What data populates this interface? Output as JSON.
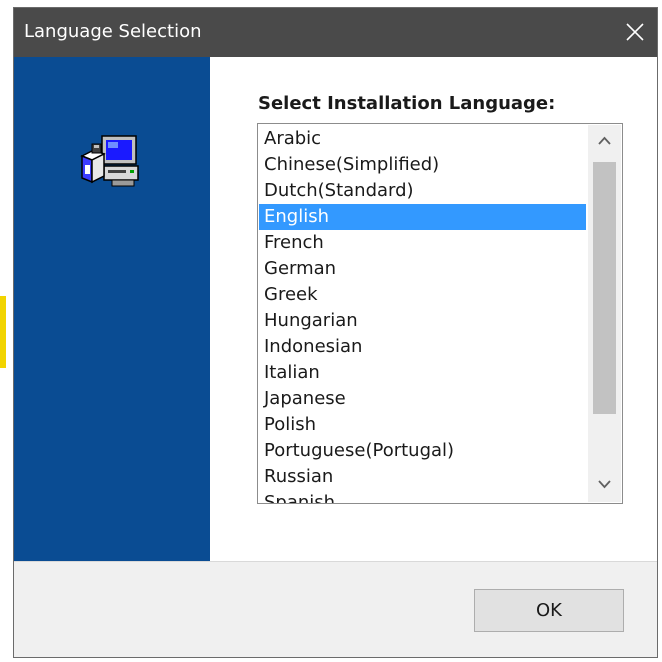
{
  "window": {
    "title": "Language Selection",
    "close_icon": "close-icon",
    "titlebar_color": "#4a4a4a"
  },
  "side_panel": {
    "icon": "setup-computer-icon",
    "color": "#0a4c93"
  },
  "language_list": {
    "prompt": "Select Installation Language:",
    "selected": "English",
    "items": [
      {
        "label": "Arabic"
      },
      {
        "label": "Chinese(Simplified)"
      },
      {
        "label": "Dutch(Standard)"
      },
      {
        "label": "English"
      },
      {
        "label": "French"
      },
      {
        "label": "German"
      },
      {
        "label": "Greek"
      },
      {
        "label": "Hungarian"
      },
      {
        "label": "Indonesian"
      },
      {
        "label": "Italian"
      },
      {
        "label": "Japanese"
      },
      {
        "label": "Polish"
      },
      {
        "label": "Portuguese(Portugal)"
      },
      {
        "label": "Russian"
      },
      {
        "label": "Spanish"
      }
    ],
    "scroll_up_icon": "chevron-up-icon",
    "scroll_down_icon": "chevron-down-icon",
    "selection_color": "#3399ff"
  },
  "footer": {
    "ok_label": "OK"
  }
}
